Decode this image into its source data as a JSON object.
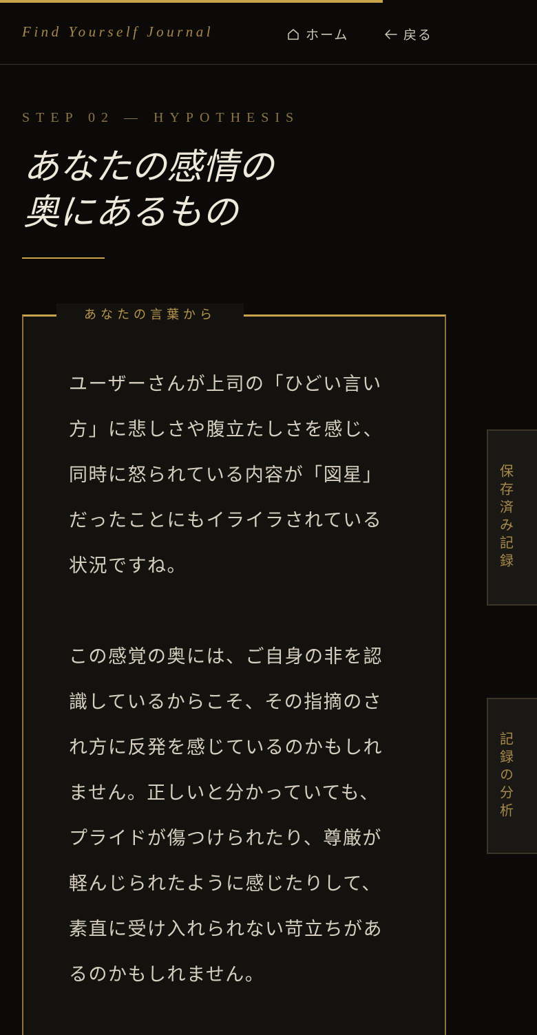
{
  "progress": {
    "fraction": 0.713
  },
  "header": {
    "brand": "Find Yourself Journal",
    "home_label": "ホーム",
    "back_label": "戻る",
    "home_icon": "home-icon",
    "back_icon": "arrow-left-icon"
  },
  "step": {
    "label": "STEP 02 — HYPOTHESIS",
    "title_line1": "あなたの感情の",
    "title_line2": "奥にあるもの"
  },
  "quote": {
    "tag": "あなたの言葉から",
    "paragraph1": "ユーザーさんが上司の「ひどい言い方」に悲しさや腹立たしさを感じ、同時に怒られている内容が「図星」だったことにもイライラされている状況ですね。",
    "paragraph2": "この感覚の奥には、ご自身の非を認識しているからこそ、その指摘のされ方に反発を感じているのかもしれません。正しいと分かっていても、プライドが傷つけられたり、尊厳が軽んじられたように感じたりして、素直に受け入れられない苛立ちがあるのかもしれません。"
  },
  "side_tabs": {
    "saved_label": "保存済み記録",
    "analysis_label": "記録の分析"
  },
  "colors": {
    "accent": "#c9a24c",
    "background": "#0b0a08"
  }
}
